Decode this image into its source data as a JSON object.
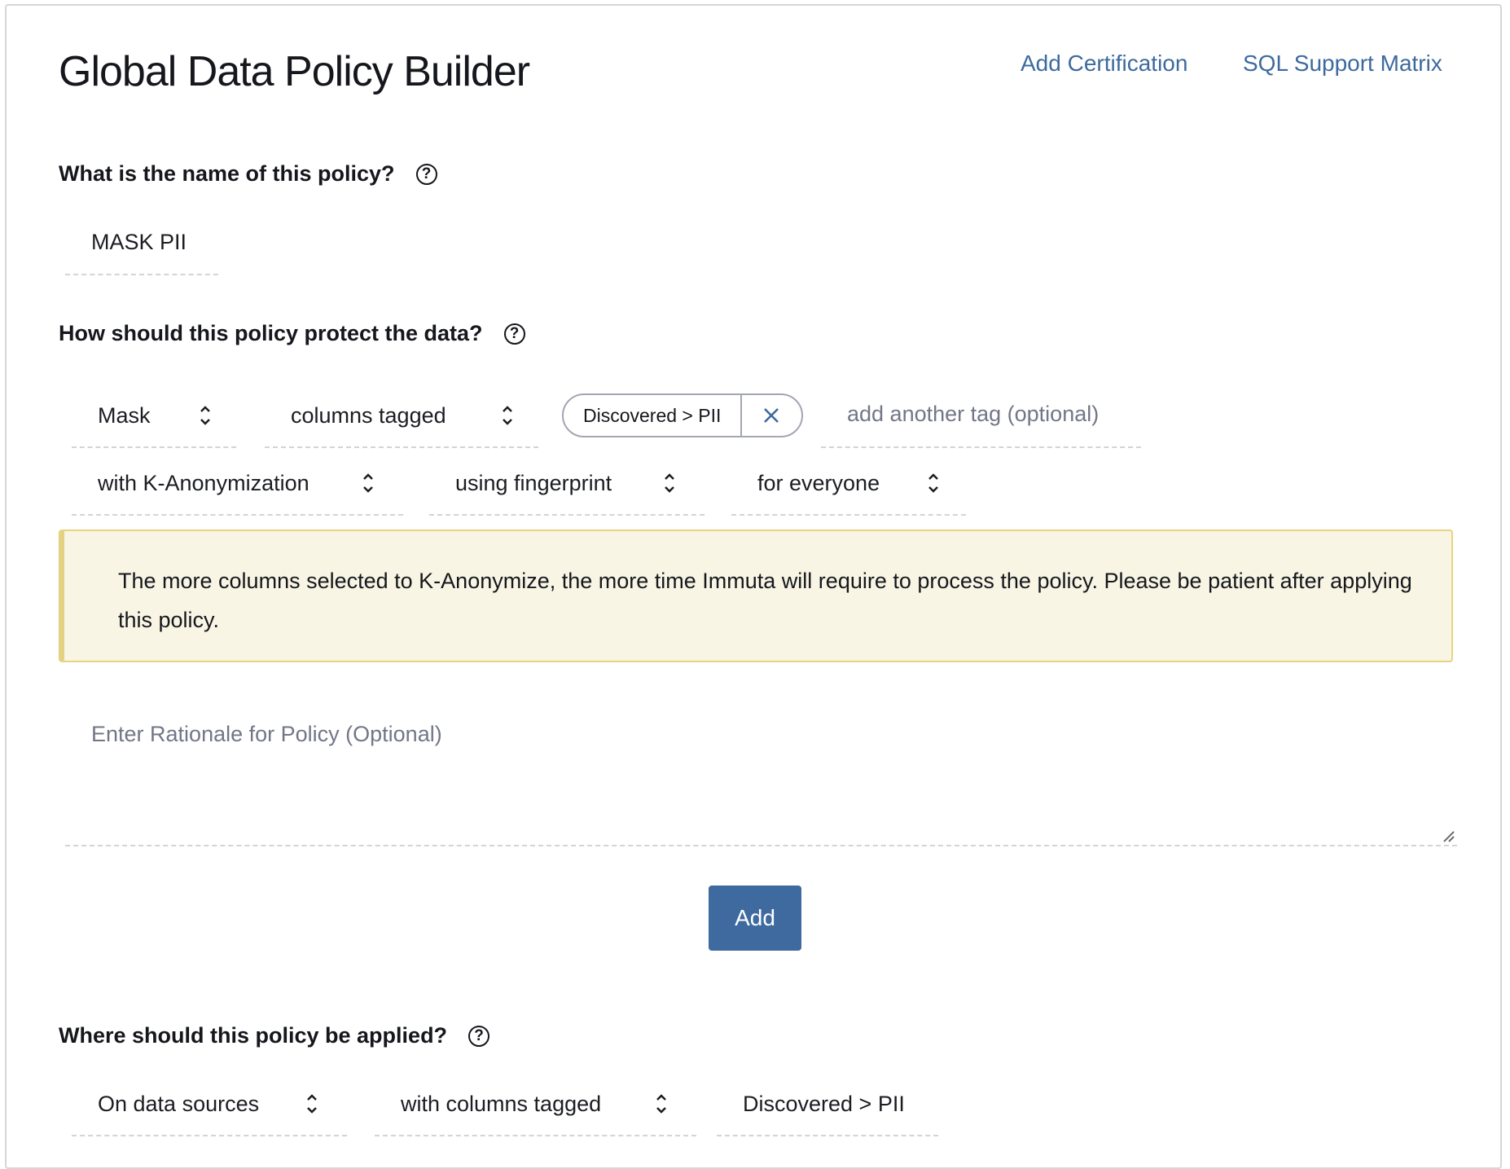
{
  "page": {
    "title": "Global Data Policy Builder",
    "links": [
      {
        "label": "Add Certification"
      },
      {
        "label": "SQL Support Matrix"
      }
    ]
  },
  "name_section": {
    "heading": "What is the name of this policy?",
    "help_icon": "question-circle-icon",
    "policy_name_value": "MASK PII"
  },
  "protect_section": {
    "heading": "How should this policy protect the data?",
    "help_icon": "question-circle-icon",
    "action_select": "Mask",
    "target_select": "columns tagged",
    "tags": [
      {
        "label": "Discovered > PII",
        "remove_icon": "close-icon"
      }
    ],
    "add_tag_placeholder": "add another tag (optional)",
    "method_select": "with K-Anonymization",
    "technique_select": "using fingerprint",
    "audience_select": "for everyone",
    "notice": "The more columns selected to K-Anonymize, the more time Immuta will require to process the policy. Please be patient after applying this policy.",
    "rationale_placeholder": "Enter Rationale for Policy (Optional)",
    "add_button": "Add"
  },
  "apply_section": {
    "heading": "Where should this policy be applied?",
    "help_icon": "question-circle-icon",
    "scope_select": "On data sources",
    "condition_select": "with columns tagged",
    "condition_value": "Discovered > PII"
  },
  "colors": {
    "link": "#3d6a9e",
    "button": "#3e6a9f",
    "notice_bg": "#f9f5e5",
    "notice_border": "#e6d47f",
    "placeholder": "#737687"
  }
}
